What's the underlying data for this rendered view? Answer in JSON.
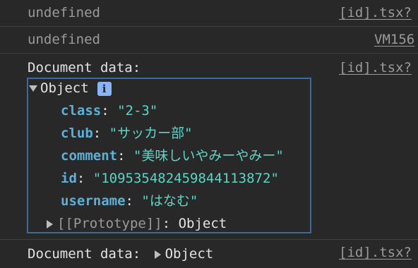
{
  "console": {
    "rows": [
      {
        "message": "undefined",
        "source": "[id].tsx?"
      },
      {
        "message": "undefined",
        "source": "VM156"
      },
      {
        "message": "Document data:",
        "source": "[id].tsx?"
      },
      {
        "message": "Document data:",
        "source": "[id].tsx?"
      }
    ],
    "expanded_object": {
      "label": "Object",
      "info_icon_text": "i",
      "properties": [
        {
          "key": "class",
          "value": "\"2-3\""
        },
        {
          "key": "club",
          "value": "\"サッカー部\""
        },
        {
          "key": "comment",
          "value": "\"美味しいやみーやみー\""
        },
        {
          "key": "id",
          "value": "\"109535482459844113872\""
        },
        {
          "key": "username",
          "value": "\"はなむ\""
        }
      ],
      "prototype_label": "[[Prototype]]",
      "prototype_value": "Object"
    },
    "collapsed_object_label": "Object",
    "colors": {
      "background": "#282828",
      "key": "#5db0d7",
      "string": "#5cd5c7",
      "muted": "#9a9a9a",
      "highlight_border": "#3a6aa0",
      "info_badge": "#8ab4f8"
    }
  }
}
